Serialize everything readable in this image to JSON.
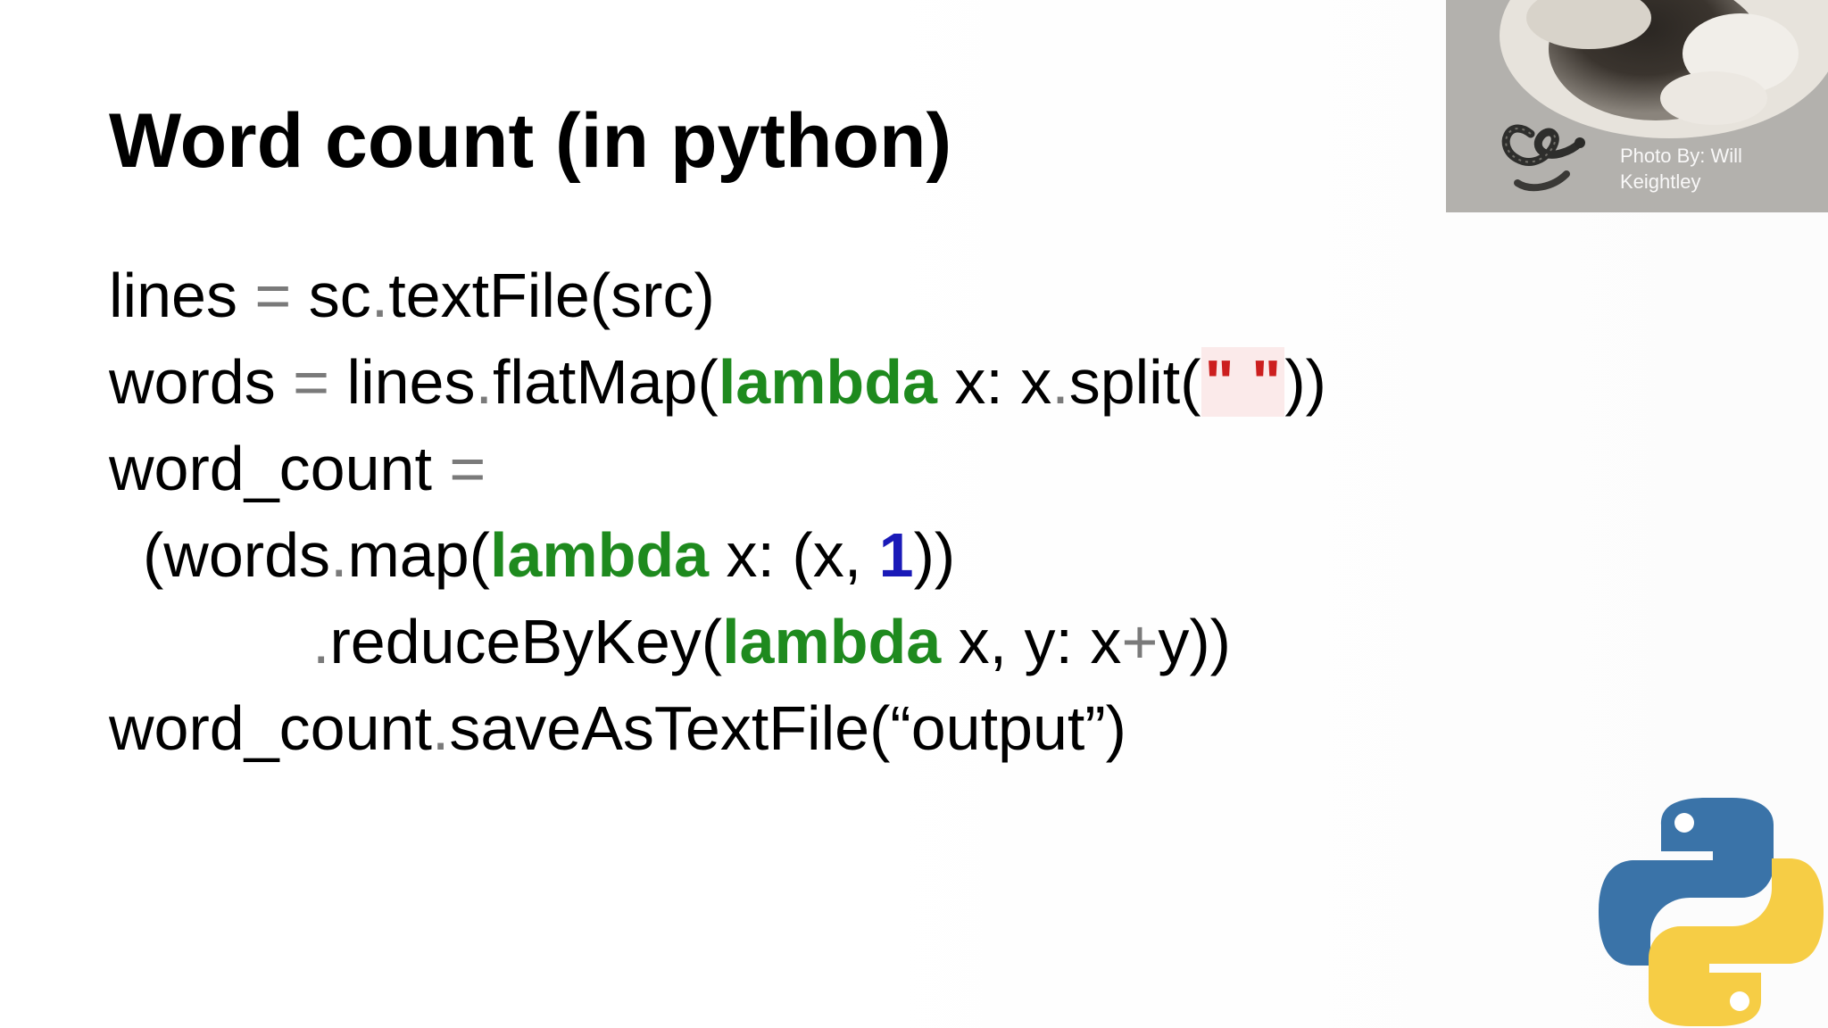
{
  "slide": {
    "title": "Word count (in python)",
    "photo_credit": "Photo By: Will Keightley",
    "code": {
      "l1": {
        "a": "lines ",
        "op": "=",
        "b": " sc",
        "dot": ".",
        "c": "textFile(src)"
      },
      "l2": {
        "a": "words ",
        "op": "=",
        "b": " lines",
        "dot1": ".",
        "c": "flatMap(",
        "kw": "lambda",
        "d": " x: x",
        "dot2": ".",
        "e": "split(",
        "str": "\" \"",
        "f": "))"
      },
      "l3": {
        "a": "word_count ",
        "op": "="
      },
      "l4": {
        "a": "(words",
        "dot": ".",
        "b": "map(",
        "kw": "lambda",
        "c": " x: (x, ",
        "num": "1",
        "d": "))"
      },
      "l5": {
        "dot": ".",
        "a": "reduceByKey(",
        "kw": "lambda",
        "b": " x, y: x",
        "op": "+",
        "c": "y))"
      },
      "l6": {
        "a": "word_count",
        "dot": ".",
        "b": "saveAsTextFile(“output”)"
      }
    }
  }
}
